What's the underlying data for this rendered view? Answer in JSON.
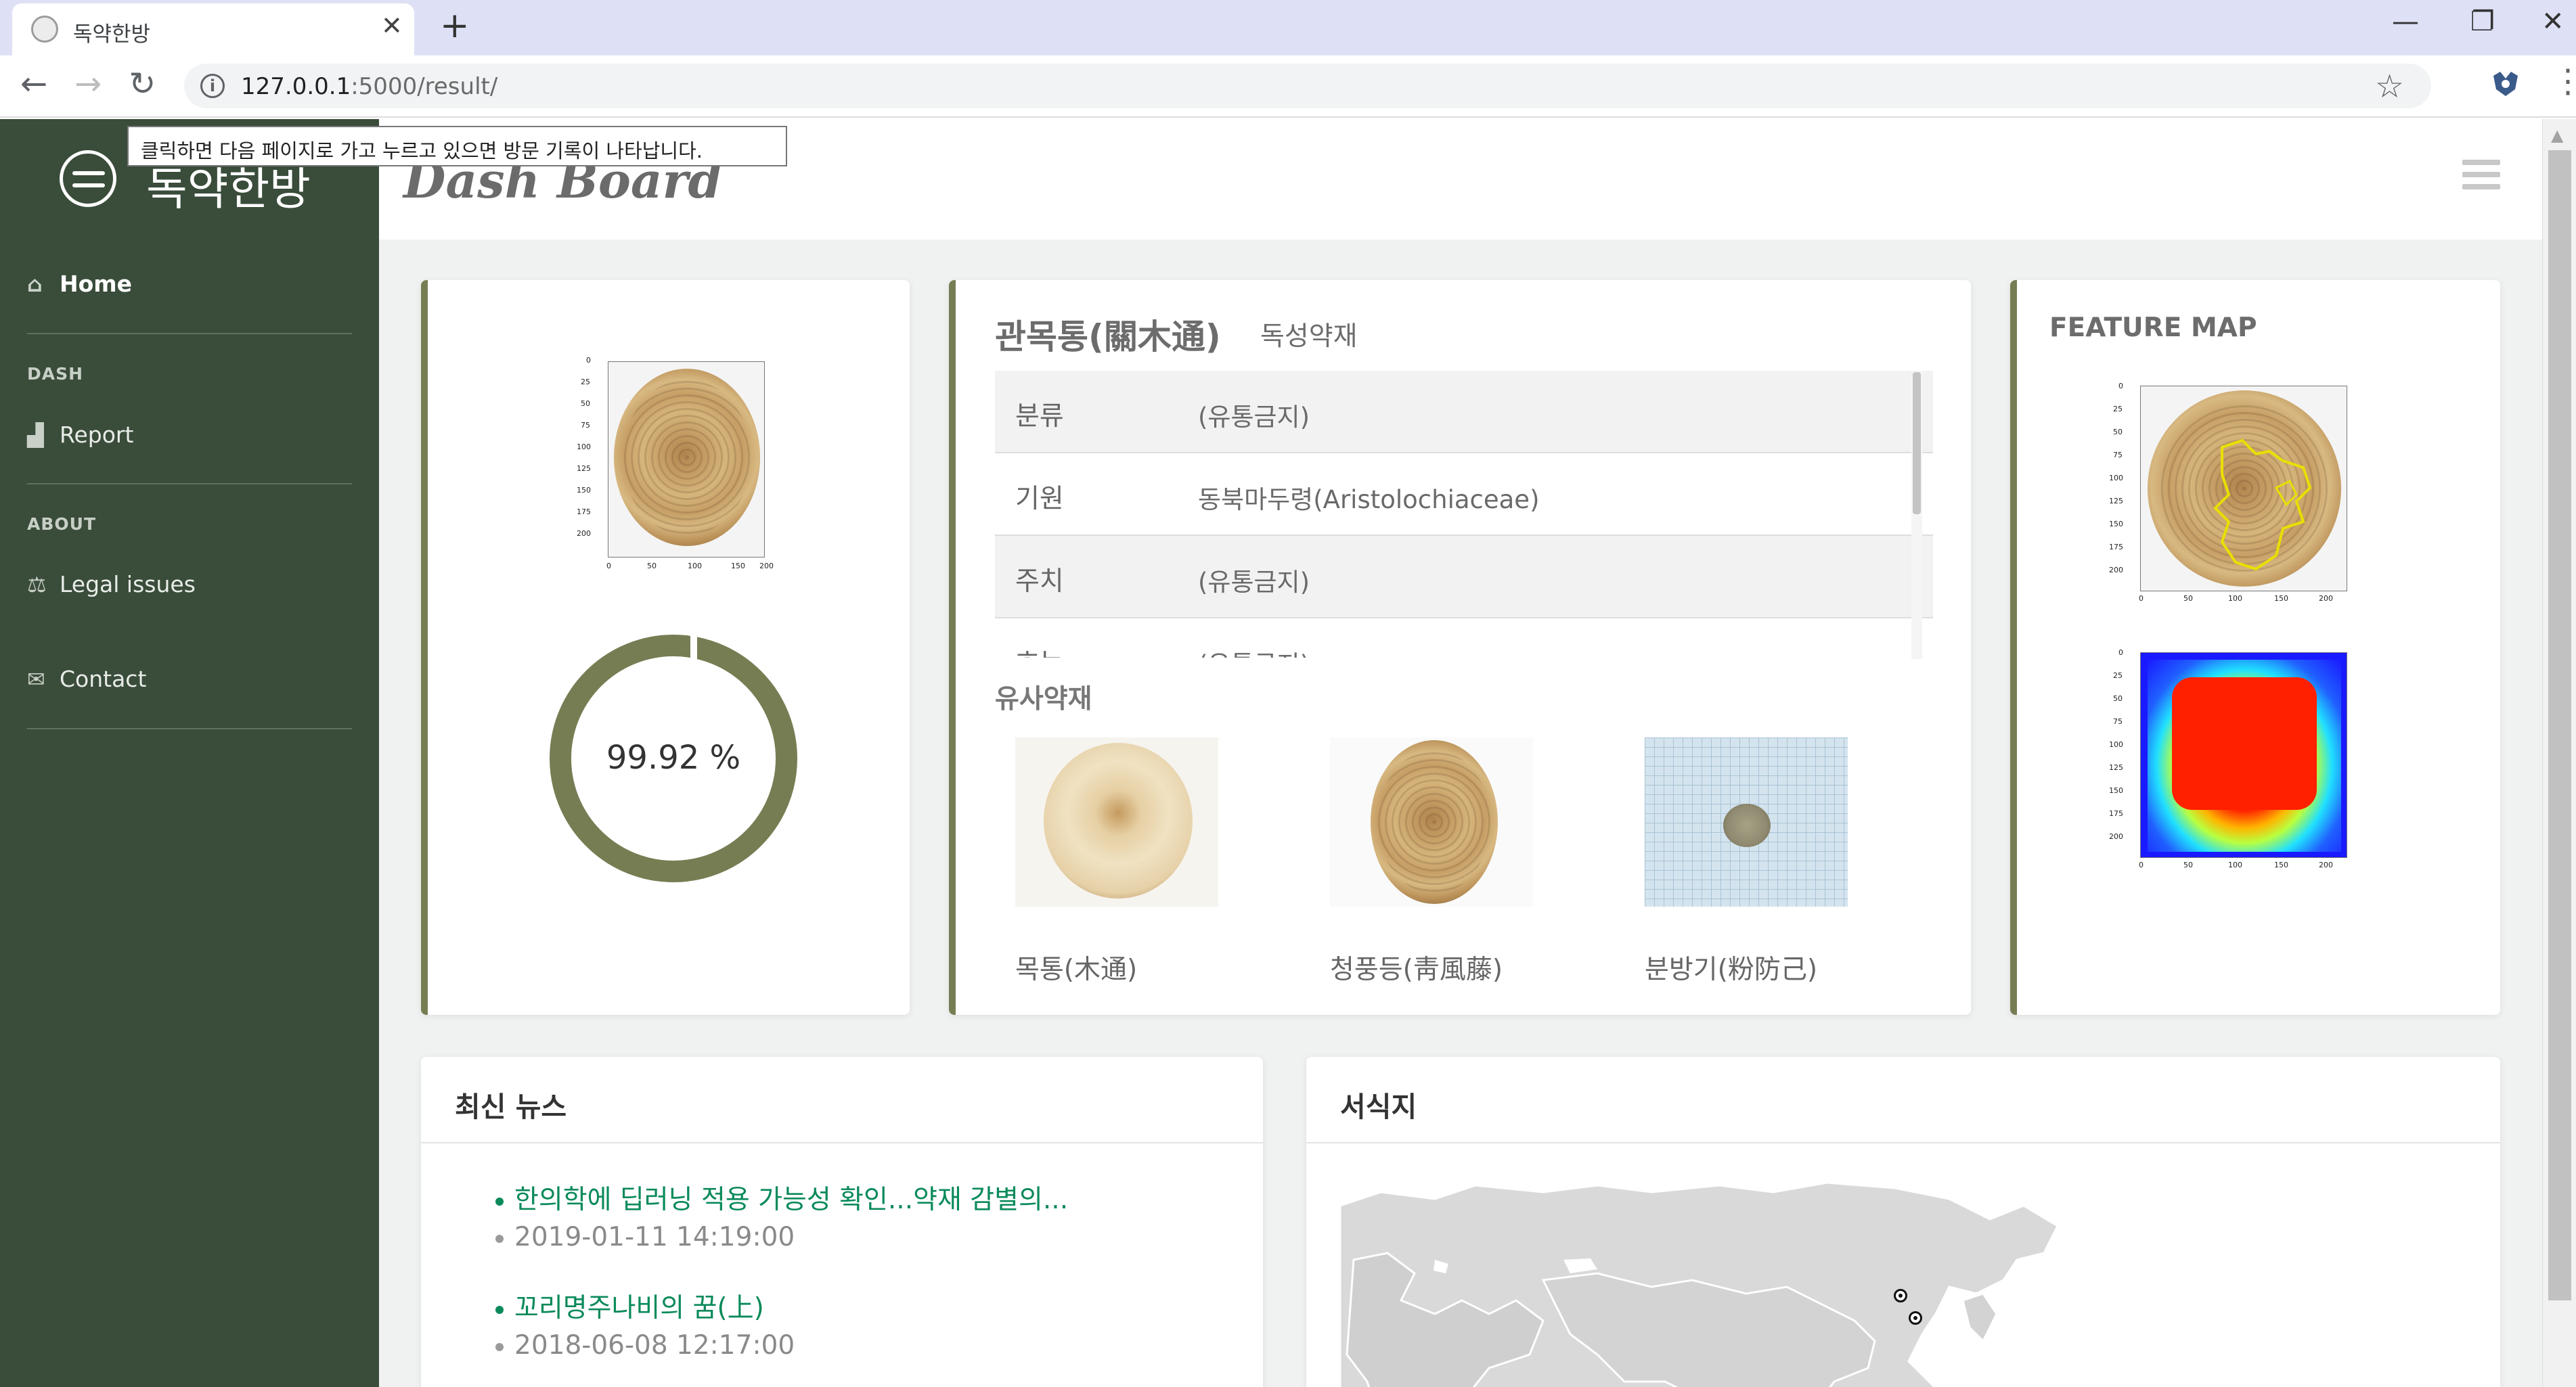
{
  "browser": {
    "tab_title": "독약한방",
    "url_host": "127.0.0.1",
    "url_path": ":5000/result/",
    "tooltip": "클릭하면 다음 페이지로 가고 누르고 있으면 방문 기록이 나타납니다."
  },
  "sidebar": {
    "brand": "독약한방",
    "home_label": "Home",
    "dash_heading": "DASH",
    "report_label": "Report",
    "about_heading": "ABOUT",
    "legal_label": "Legal issues",
    "contact_label": "Contact"
  },
  "header": {
    "title": "Dash Board"
  },
  "prediction": {
    "confidence_text": "99.92 %",
    "confidence_value": 99.92
  },
  "herb": {
    "name": "관목통(關木通)",
    "tag": "독성약재",
    "rows": [
      {
        "key": "분류",
        "value": "(유통금지)"
      },
      {
        "key": "기원",
        "value": "동북마두령(Aristolochiaceae)"
      },
      {
        "key": "주치",
        "value": "(유통금지)"
      },
      {
        "key": "효능",
        "value": "(유통금지)"
      }
    ],
    "similar_heading": "유사약재",
    "similar": [
      {
        "name": "목통(木通)"
      },
      {
        "name": "청풍등(靑風藤)"
      },
      {
        "name": "분방기(粉防己)"
      }
    ]
  },
  "feature_map": {
    "title": "FEATURE MAP"
  },
  "plot_axes": {
    "y_ticks": [
      "0",
      "25",
      "50",
      "75",
      "100",
      "125",
      "150",
      "175",
      "200"
    ],
    "x_ticks": [
      "0",
      "50",
      "100",
      "150",
      "200"
    ]
  },
  "news": {
    "title": "최신 뉴스",
    "items": [
      {
        "headline": "한의학에 딥러닝 적용 가능성 확인...약재 감별의...",
        "date": "2019-01-11 14:19:00"
      },
      {
        "headline": "꼬리명주나비의 꿈(上)",
        "date": "2018-06-08 12:17:00"
      }
    ]
  },
  "habitat": {
    "title": "서식지"
  },
  "colors": {
    "sidebar_bg": "#3a4c3a",
    "accent": "#777d53",
    "news_link": "#0a8a5a"
  }
}
